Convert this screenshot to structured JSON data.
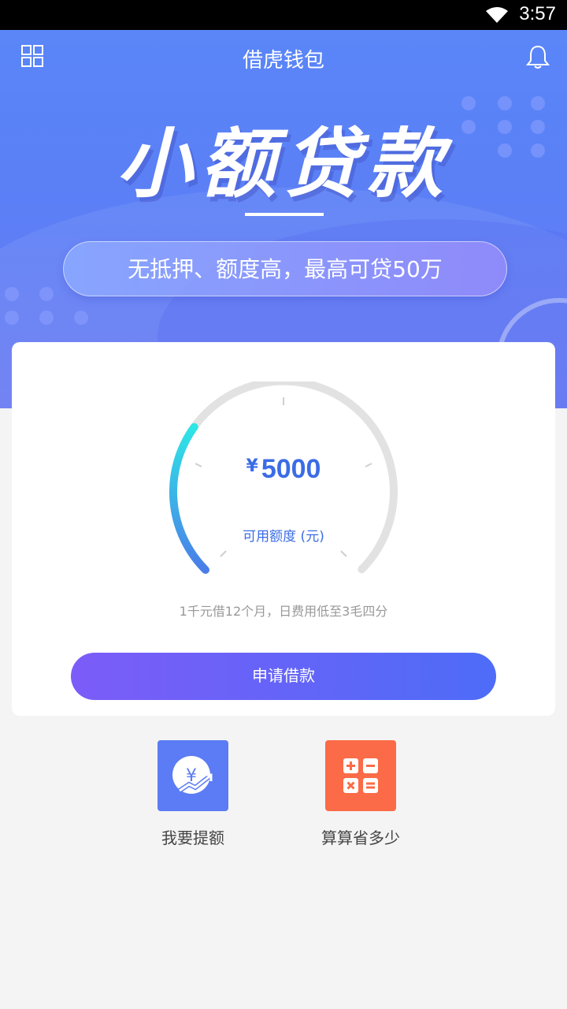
{
  "status_bar": {
    "time": "3:57"
  },
  "header": {
    "title": "借虎钱包"
  },
  "banner": {
    "title": "小额贷款",
    "tagline": "无抵押、额度高，最高可贷50万"
  },
  "credit_card": {
    "currency_symbol": "¥",
    "amount": "5000",
    "amount_label": "可用额度 (元)",
    "gauge_fill_fraction": 0.3,
    "hint": "1千元借12个月，日费用低至3毛四分",
    "apply_label": "申请借款"
  },
  "shortcuts": [
    {
      "label": "我要提额",
      "icon": "yen-growth-icon",
      "color": "#5b7cf4"
    },
    {
      "label": "算算省多少",
      "icon": "calculator-icon",
      "color": "#fb6b47"
    }
  ],
  "colors": {
    "accent": "#3b6ce6",
    "button_start": "#7c5cf8",
    "button_end": "#4d6cf7",
    "gauge_start": "#2ee6e6"
  }
}
